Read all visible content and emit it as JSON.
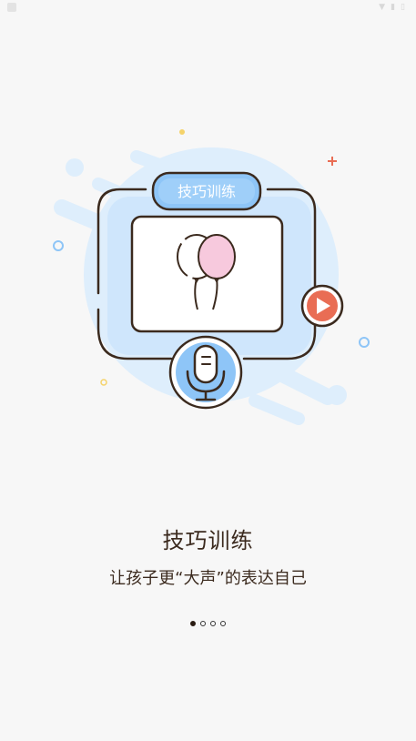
{
  "illustration": {
    "badge_text": "技巧训练"
  },
  "content": {
    "title": "技巧训练",
    "subtitle": "让孩子更“大声”的表达自己"
  },
  "pager": {
    "total": 4,
    "active_index": 0
  },
  "colors": {
    "background": "#f7f7f7",
    "accent_blue": "#8ec5f7",
    "light_blue": "#d8ecfd",
    "outline": "#3b2a1e",
    "play_red": "#e96d54",
    "balloon_pink": "#f7c9dd"
  }
}
